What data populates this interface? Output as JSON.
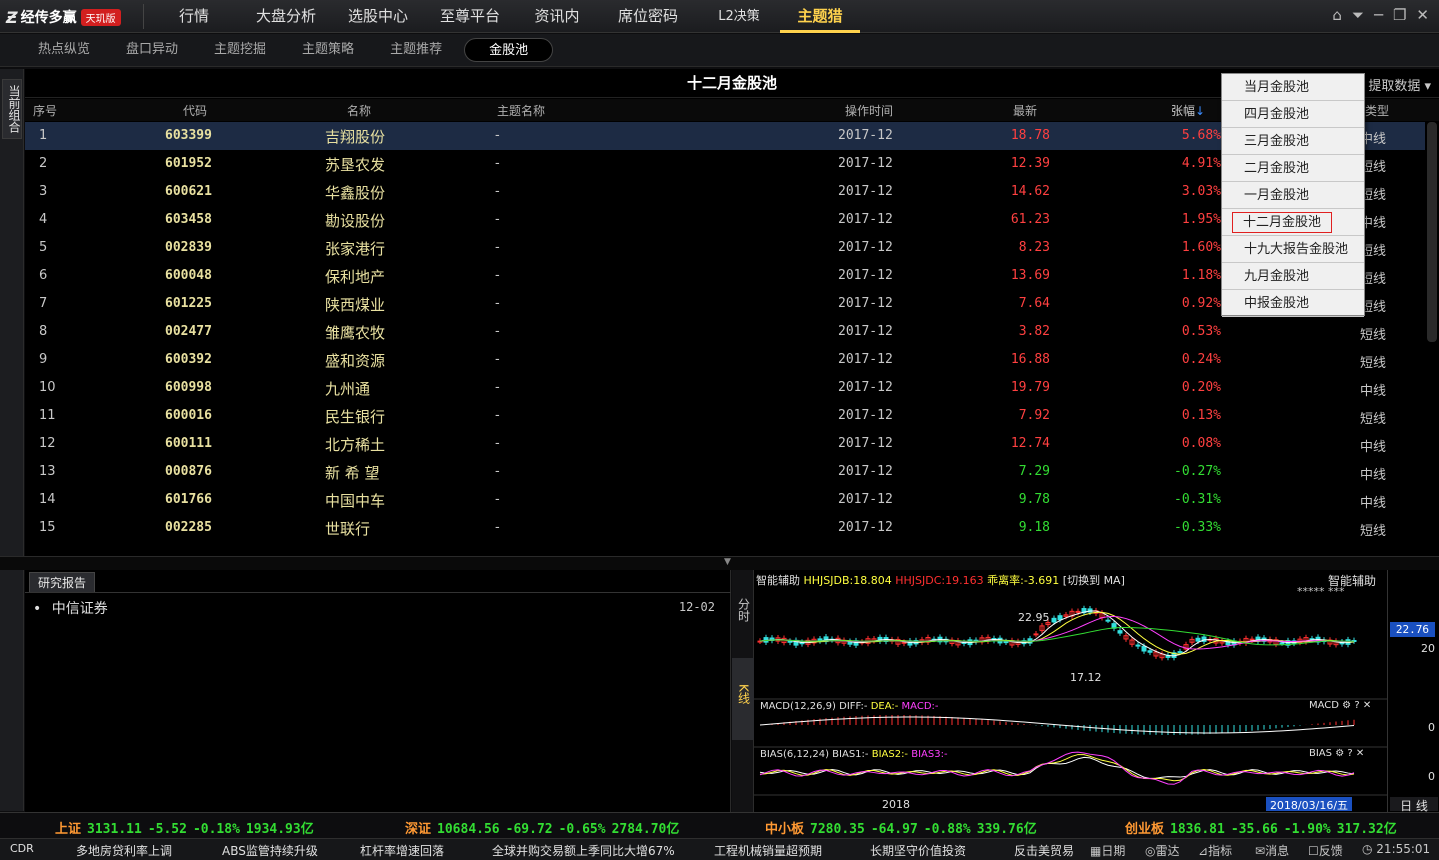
{
  "app": {
    "brand": "经传多赢",
    "edition": "天玑版"
  },
  "nav": [
    "行情",
    "大盘分析",
    "选股中心",
    "至尊平台",
    "资讯内参",
    "席位密码",
    "L2决策",
    "主题猎手"
  ],
  "nav_active": "主题猎手",
  "subtabs": [
    "热点纵览",
    "盘口异动",
    "主题挖掘",
    "主题策略",
    "主题推荐",
    "金股池"
  ],
  "subtab_active": "金股池",
  "left_tab": "当前组合",
  "table": {
    "title": "十二月金股池",
    "extract_label": "提取数据",
    "headers": {
      "idx": "序号",
      "code": "代码",
      "name": "名称",
      "topic": "主题名称",
      "time": "操作时间",
      "price": "最新",
      "chg": "张幅",
      "type": "类型"
    },
    "rows": [
      {
        "idx": "1",
        "code": "603399",
        "name": "吉翔股份",
        "topic": "-",
        "time": "2017-12",
        "price": "18.78",
        "chg": "5.68%",
        "type": "中线",
        "dir": "up"
      },
      {
        "idx": "2",
        "code": "601952",
        "name": "苏垦农发",
        "topic": "-",
        "time": "2017-12",
        "price": "12.39",
        "chg": "4.91%",
        "type": "短线",
        "dir": "up"
      },
      {
        "idx": "3",
        "code": "600621",
        "name": "华鑫股份",
        "topic": "-",
        "time": "2017-12",
        "price": "14.62",
        "chg": "3.03%",
        "type": "短线",
        "dir": "up"
      },
      {
        "idx": "4",
        "code": "603458",
        "name": "勘设股份",
        "topic": "-",
        "time": "2017-12",
        "price": "61.23",
        "chg": "1.95%",
        "type": "中线",
        "dir": "up"
      },
      {
        "idx": "5",
        "code": "002839",
        "name": "张家港行",
        "topic": "-",
        "time": "2017-12",
        "price": "8.23",
        "chg": "1.60%",
        "type": "短线",
        "dir": "up"
      },
      {
        "idx": "6",
        "code": "600048",
        "name": "保利地产",
        "topic": "-",
        "time": "2017-12",
        "price": "13.69",
        "chg": "1.18%",
        "type": "短线",
        "dir": "up"
      },
      {
        "idx": "7",
        "code": "601225",
        "name": "陕西煤业",
        "topic": "-",
        "time": "2017-12",
        "price": "7.64",
        "chg": "0.92%",
        "type": "短线",
        "dir": "up"
      },
      {
        "idx": "8",
        "code": "002477",
        "name": "雏鹰农牧",
        "topic": "-",
        "time": "2017-12",
        "price": "3.82",
        "chg": "0.53%",
        "type": "短线",
        "dir": "up"
      },
      {
        "idx": "9",
        "code": "600392",
        "name": "盛和资源",
        "topic": "-",
        "time": "2017-12",
        "price": "16.88",
        "chg": "0.24%",
        "type": "短线",
        "dir": "up"
      },
      {
        "idx": "10",
        "code": "600998",
        "name": "九州通",
        "topic": "-",
        "time": "2017-12",
        "price": "19.79",
        "chg": "0.20%",
        "type": "中线",
        "dir": "up"
      },
      {
        "idx": "11",
        "code": "600016",
        "name": "民生银行",
        "topic": "-",
        "time": "2017-12",
        "price": "7.92",
        "chg": "0.13%",
        "type": "短线",
        "dir": "up"
      },
      {
        "idx": "12",
        "code": "600111",
        "name": "北方稀土",
        "topic": "-",
        "time": "2017-12",
        "price": "12.74",
        "chg": "0.08%",
        "type": "中线",
        "dir": "up"
      },
      {
        "idx": "13",
        "code": "000876",
        "name": "新 希 望",
        "topic": "-",
        "time": "2017-12",
        "price": "7.29",
        "chg": "-0.27%",
        "type": "中线",
        "dir": "down"
      },
      {
        "idx": "14",
        "code": "601766",
        "name": "中国中车",
        "topic": "-",
        "time": "2017-12",
        "price": "9.78",
        "chg": "-0.31%",
        "type": "中线",
        "dir": "down"
      },
      {
        "idx": "15",
        "code": "002285",
        "name": "世联行",
        "topic": "-",
        "time": "2017-12",
        "price": "9.18",
        "chg": "-0.33%",
        "type": "短线",
        "dir": "down"
      }
    ]
  },
  "dropdown": {
    "items": [
      "当月金股池",
      "四月金股池",
      "三月金股池",
      "二月金股池",
      "一月金股池",
      "十二月金股池",
      "十九大报告金股池",
      "九月金股池",
      "中报金股池"
    ],
    "active": "十二月金股池"
  },
  "report": {
    "tab": "研究报告",
    "items": [
      {
        "source": "中信证券",
        "date": "12-02"
      }
    ]
  },
  "chart": {
    "side_tabs": [
      "分时",
      "K线"
    ],
    "side_active": "K线",
    "head": {
      "label": "智能辅助",
      "jdb": "HHJSJDB:18.804",
      "jdc": "HHJSJDC:19.163",
      "dev": "乖离率:-3.691",
      "switch": "[切换到 MA]"
    },
    "right_label": "智能辅助",
    "right_stars": "***** ***",
    "high_label": "22.95",
    "low_label": "17.12",
    "price_badge": "22.76",
    "axis_ticks": [
      "20",
      "0",
      "0"
    ],
    "macd_head": {
      "name": "MACD(12,26,9)",
      "diff": "DIFF:-",
      "dea": "DEA:-",
      "macd": "MACD:-"
    },
    "macd_label": "MACD",
    "bias_head": {
      "name": "BIAS(6,12,24)",
      "b1": "BIAS1:-",
      "b2": "BIAS2:-",
      "b3": "BIAS3:-"
    },
    "bias_label": "BIAS",
    "x_label": "2018",
    "date_label": "2018/03/16/五",
    "period_tabs": [
      "日",
      "线"
    ]
  },
  "status": [
    {
      "name": "上证",
      "val": "3131.11",
      "chg": "-5.52",
      "pct": "-0.18%",
      "amt": "1934.93亿"
    },
    {
      "name": "深证",
      "val": "10684.56",
      "chg": "-69.72",
      "pct": "-0.65%",
      "amt": "2784.70亿"
    },
    {
      "name": "中小板",
      "val": "7280.35",
      "chg": "-64.97",
      "pct": "-0.88%",
      "amt": "339.76亿"
    },
    {
      "name": "创业板",
      "val": "1836.81",
      "chg": "-35.66",
      "pct": "-1.90%",
      "amt": "317.32亿"
    }
  ],
  "news": [
    "CDR",
    "多地房贷利率上调",
    "ABS监管持续升级",
    "杠杆率增速回落",
    "全球并购交易额上季同比大增67%",
    "工程机械销量超预期",
    "长期坚守价值投资",
    "反击美贸易"
  ],
  "tools": [
    "日期",
    "雷达",
    "指标",
    "消息",
    "反馈"
  ],
  "clock": "21:55:01",
  "colors": {
    "up": "#ff4040",
    "down": "#33dd33",
    "accent": "#ffd24d",
    "selected_row": "#1d2b44"
  }
}
